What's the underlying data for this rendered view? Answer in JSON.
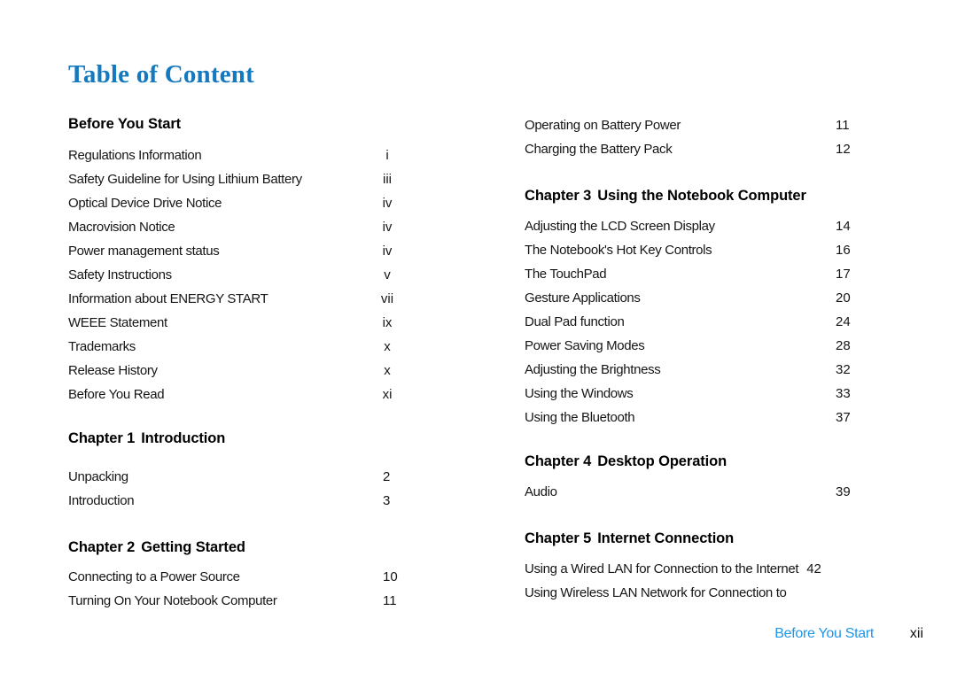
{
  "document": {
    "title": "Table of Content",
    "title_color": "#1479be"
  },
  "left_column": {
    "sections": [
      {
        "heading": {
          "number": "",
          "name": "Before You Start"
        },
        "entries": [
          {
            "label": "Regulations Information",
            "page": "i"
          },
          {
            "label": "Safety Guideline for Using Lithium Battery",
            "page": "iii"
          },
          {
            "label": "Optical Device Drive Notice",
            "page": "iv"
          },
          {
            "label": "Macrovision Notice",
            "page": "iv"
          },
          {
            "label": "Power management status",
            "page": "iv"
          },
          {
            "label": "Safety Instructions",
            "page": "v"
          },
          {
            "label": "Information about ENERGY START",
            "page": "vii"
          },
          {
            "label": "WEEE Statement",
            "page": "ix"
          },
          {
            "label": "Trademarks",
            "page": "x"
          },
          {
            "label": "Release History",
            "page": "x"
          },
          {
            "label": "Before You Read",
            "page": "xi"
          }
        ]
      },
      {
        "heading": {
          "number": "Chapter 1",
          "name": "Introduction"
        },
        "entries": [
          {
            "label": "Unpacking",
            "page": "2"
          },
          {
            "label": "Introduction",
            "page": "3"
          }
        ]
      },
      {
        "heading": {
          "number": "Chapter 2",
          "name": "Getting Started"
        },
        "entries": [
          {
            "label": "Connecting to a Power Source",
            "page": "10"
          },
          {
            "label": "Turning On Your Notebook Computer",
            "page": "11"
          }
        ]
      }
    ]
  },
  "right_column": {
    "continued_entries": [
      {
        "label": "Operating on Battery Power",
        "page": "11"
      },
      {
        "label": "Charging the Battery Pack",
        "page": "12"
      }
    ],
    "sections": [
      {
        "heading": {
          "number": "Chapter 3",
          "name": "Using the Notebook Computer"
        },
        "entries": [
          {
            "label": "Adjusting the LCD Screen Display",
            "page": "14"
          },
          {
            "label": "The Notebook's Hot Key Controls",
            "page": "16"
          },
          {
            "label": "The TouchPad",
            "page": "17"
          },
          {
            "label": "Gesture Applications",
            "page": "20"
          },
          {
            "label": "Dual Pad function",
            "page": "24"
          },
          {
            "label": "Power Saving Modes",
            "page": "28"
          },
          {
            "label": "Adjusting the Brightness",
            "page": "32"
          },
          {
            "label": "Using the Windows",
            "page": "33"
          },
          {
            "label": "Using the Bluetooth",
            "page": "37"
          }
        ]
      },
      {
        "heading": {
          "number": "Chapter 4",
          "name": "Desktop Operation"
        },
        "entries": [
          {
            "label": "Audio",
            "page": "39"
          }
        ]
      },
      {
        "heading": {
          "number": "Chapter 5",
          "name": "Internet Connection"
        },
        "entries": [
          {
            "label": "Using a Wired LAN for Connection to the Internet",
            "page": "42"
          },
          {
            "label": "Using Wireless LAN Network for Connection to",
            "page": ""
          }
        ]
      }
    ]
  },
  "footer": {
    "label": "Before You Start",
    "page": "xii",
    "label_color": "#2196e8"
  }
}
